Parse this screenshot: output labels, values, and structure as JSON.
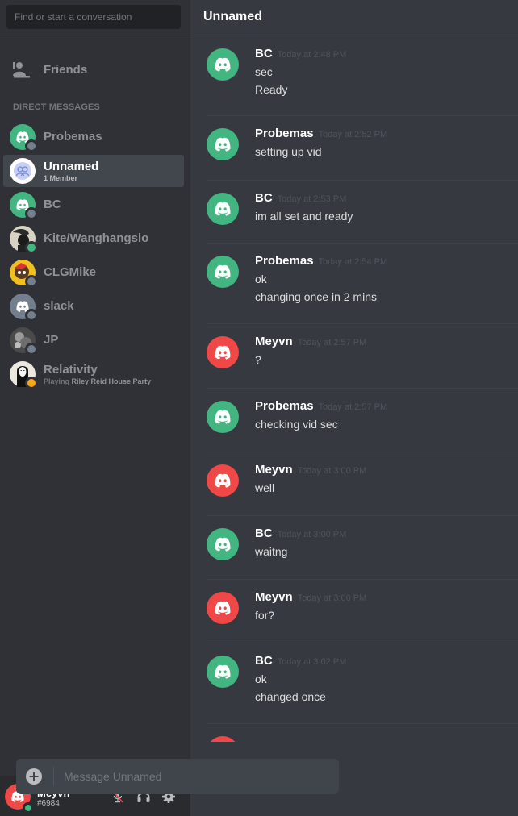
{
  "search": {
    "placeholder": "Find or start a conversation"
  },
  "friends": {
    "label": "Friends",
    "icon": "friends-icon"
  },
  "dm_header": "DIRECT MESSAGES",
  "dms": [
    {
      "name": "Probemas",
      "sub": "",
      "avatar": "discord-green",
      "status": "offline"
    },
    {
      "name": "Unnamed",
      "sub": "1 Member",
      "avatar": "group",
      "status": "none",
      "selected": true
    },
    {
      "name": "BC",
      "sub": "",
      "avatar": "discord-green",
      "status": "offline"
    },
    {
      "name": "Kite/Wanghangslo",
      "sub": "",
      "avatar": "photo-dark",
      "status": "online"
    },
    {
      "name": "CLGMike",
      "sub": "",
      "avatar": "photo-yellow",
      "status": "offline"
    },
    {
      "name": "slack",
      "sub": "",
      "avatar": "discord-grey",
      "status": "offline"
    },
    {
      "name": "JP",
      "sub": "",
      "avatar": "photo-grey",
      "status": "offline"
    },
    {
      "name": "Relativity",
      "sub_prefix": "Playing ",
      "sub_game": "Riley Reid House Party",
      "avatar": "photo-noface",
      "status": "idle"
    }
  ],
  "user": {
    "name": "Meyvn",
    "discriminator": "#6984",
    "status": "online"
  },
  "user_controls": [
    "mute-mic-icon",
    "headphones-icon",
    "settings-icon"
  ],
  "channel": {
    "title": "Unnamed"
  },
  "messages": [
    {
      "author": "BC",
      "timestamp": "Today at 2:48 PM",
      "lines": [
        "sec",
        "Ready"
      ],
      "avatar": "discord-green"
    },
    {
      "author": "Probemas",
      "timestamp": "Today at 2:52 PM",
      "lines": [
        "setting up vid"
      ],
      "avatar": "discord-green"
    },
    {
      "author": "BC",
      "timestamp": "Today at 2:53 PM",
      "lines": [
        "im all set and ready"
      ],
      "avatar": "discord-green"
    },
    {
      "author": "Probemas",
      "timestamp": "Today at 2:54 PM",
      "lines": [
        "ok",
        "changing once in 2 mins"
      ],
      "avatar": "discord-green"
    },
    {
      "author": "Meyvn",
      "timestamp": "Today at 2:57 PM",
      "lines": [
        "?"
      ],
      "avatar": "discord-red"
    },
    {
      "author": "Probemas",
      "timestamp": "Today at 2:57 PM",
      "lines": [
        "checking vid sec"
      ],
      "avatar": "discord-green"
    },
    {
      "author": "Meyvn",
      "timestamp": "Today at 3:00 PM",
      "lines": [
        "well"
      ],
      "avatar": "discord-red"
    },
    {
      "author": "BC",
      "timestamp": "Today at 3:00 PM",
      "lines": [
        "waitng"
      ],
      "avatar": "discord-green"
    },
    {
      "author": "Meyvn",
      "timestamp": "Today at 3:00 PM",
      "lines": [
        "for?"
      ],
      "avatar": "discord-red"
    },
    {
      "author": "BC",
      "timestamp": "Today at 3:02 PM",
      "lines": [
        "ok",
        "changed once"
      ],
      "avatar": "discord-green"
    }
  ],
  "composer": {
    "placeholder": "Message Unnamed"
  },
  "colors": {
    "green": "#43b581",
    "red": "#f04747",
    "grey": "#747f8d",
    "idle": "#faa61a",
    "offline": "#747f8d"
  }
}
